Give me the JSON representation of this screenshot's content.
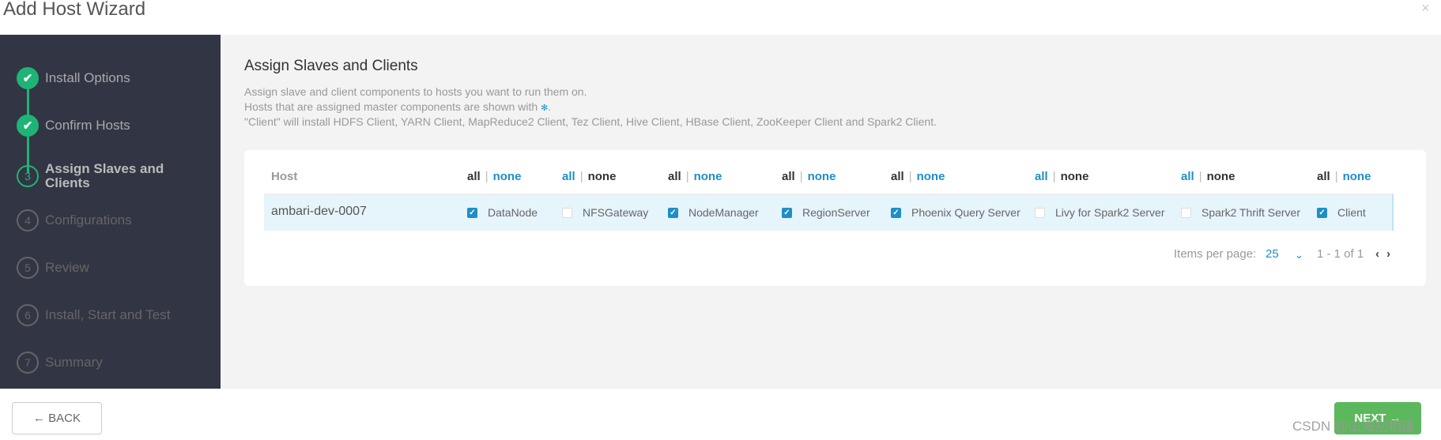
{
  "window": {
    "title": "Add Host Wizard",
    "close_icon": "close-icon"
  },
  "steps": [
    {
      "num": "1",
      "label": "Install Options",
      "state": "done"
    },
    {
      "num": "2",
      "label": "Confirm Hosts",
      "state": "done"
    },
    {
      "num": "3",
      "label": "Assign Slaves and Clients",
      "state": "active"
    },
    {
      "num": "4",
      "label": "Configurations",
      "state": "pending"
    },
    {
      "num": "5",
      "label": "Review",
      "state": "pending"
    },
    {
      "num": "6",
      "label": "Install, Start and Test",
      "state": "pending"
    },
    {
      "num": "7",
      "label": "Summary",
      "state": "pending"
    }
  ],
  "main": {
    "heading": "Assign Slaves and Clients",
    "desc1": "Assign slave and client components to hosts you want to run them on.",
    "desc2": "Hosts that are assigned master components are shown with",
    "desc2_end": ".",
    "desc3": "\"Client\" will install HDFS Client, YARN Client, MapReduce2 Client, Tez Client, Hive Client, HBase Client, ZooKeeper Client and Spark2 Client."
  },
  "table": {
    "host_header": "Host",
    "all_label": "all",
    "none_label": "none",
    "separator": "|",
    "host": "ambari-dev-0007",
    "components": [
      {
        "name": "DataNode",
        "checked": true
      },
      {
        "name": "NFSGateway",
        "checked": false
      },
      {
        "name": "NodeManager",
        "checked": true
      },
      {
        "name": "RegionServer",
        "checked": true
      },
      {
        "name": "Phoenix Query Server",
        "checked": true
      },
      {
        "name": "Livy for Spark2 Server",
        "checked": false
      },
      {
        "name": "Spark2 Thrift Server",
        "checked": false
      },
      {
        "name": "Client",
        "checked": true
      }
    ]
  },
  "pagination": {
    "items_per_page_label": "Items per page:",
    "items_per_page": "25",
    "range": "1 - 1 of 1"
  },
  "footer": {
    "back": "← BACK",
    "next": "NEXT →"
  },
  "watermark": "CSDN @山海别相逢",
  "colors": {
    "accent": "#1e8fc6",
    "success": "#1eb475",
    "sidebar": "#323544",
    "next": "#5cb85c"
  }
}
